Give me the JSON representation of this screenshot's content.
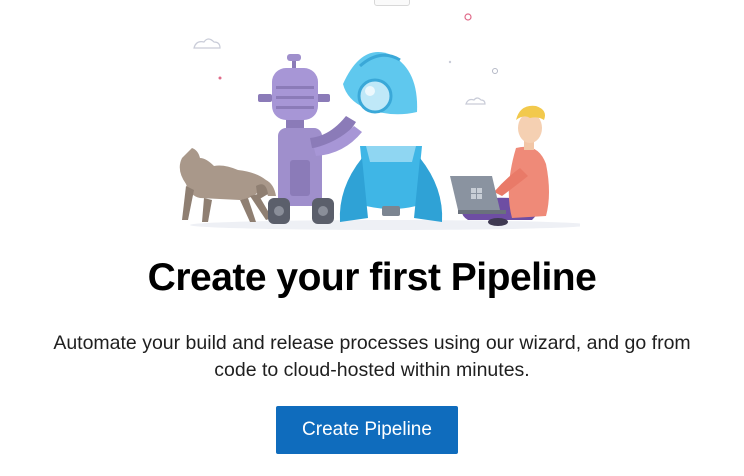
{
  "empty_state": {
    "title": "Create your first Pipeline",
    "description_line1": "Automate your build and release processes using our wizard, and go from",
    "description_line2": "code to cloud-hosted within minutes.",
    "button_label": "Create Pipeline"
  },
  "illustration": {
    "elements": [
      "robot",
      "rocket",
      "dog",
      "person-with-laptop",
      "clouds"
    ]
  },
  "colors": {
    "button_bg": "#0f6cbd",
    "button_text": "#ffffff",
    "title_text": "#000000",
    "body_text": "#1f1f1f"
  }
}
